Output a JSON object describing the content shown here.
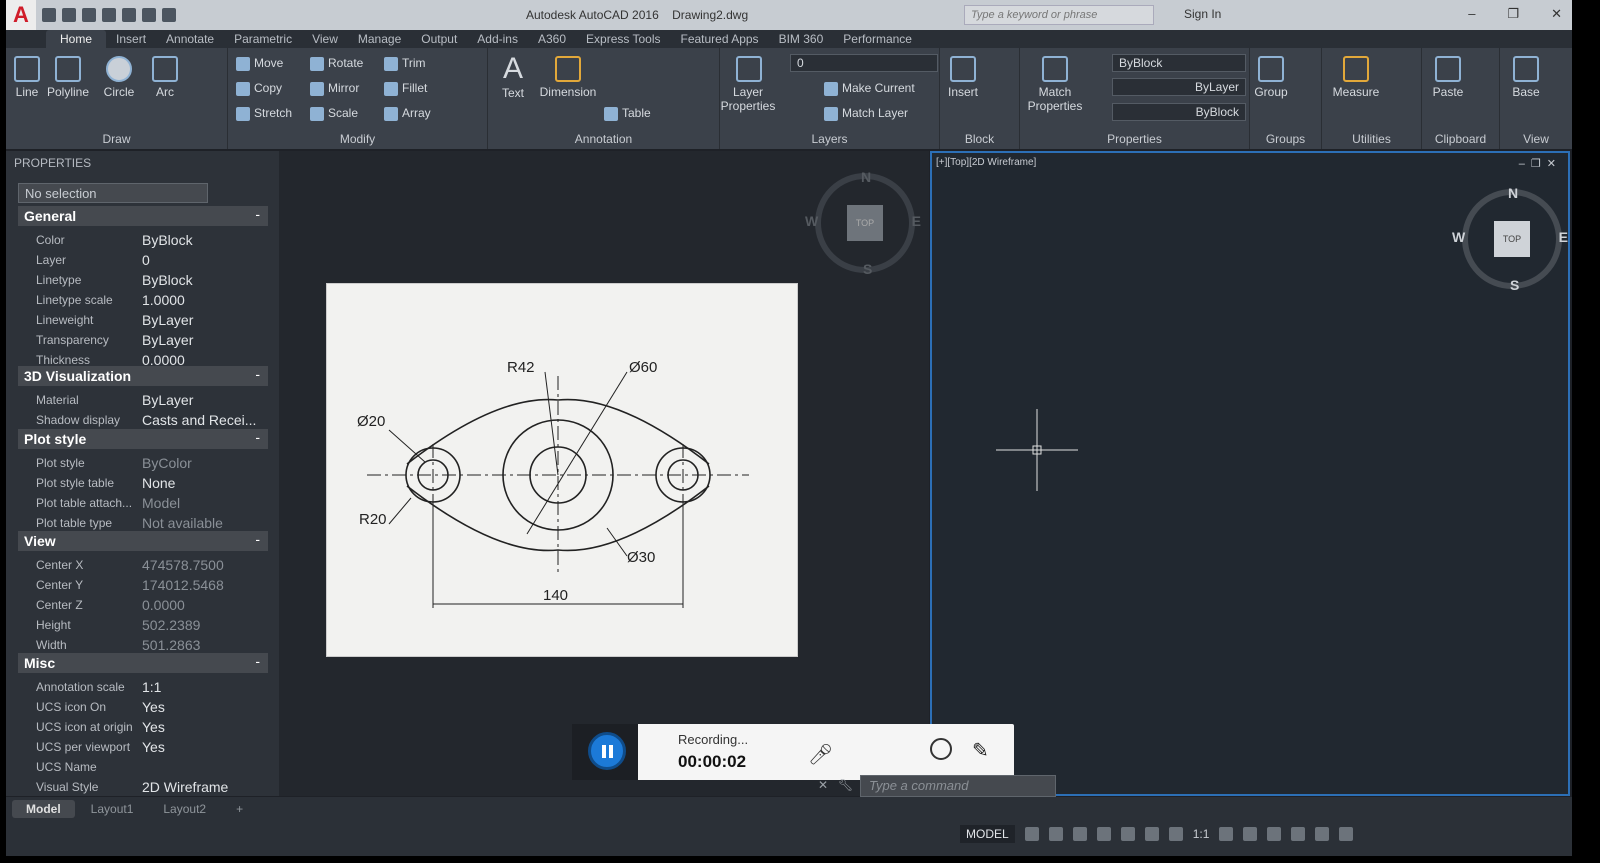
{
  "titlebar": {
    "app": "Autodesk AutoCAD 2016",
    "file": "Drawing2.dwg",
    "search_placeholder": "Type a keyword or phrase",
    "sign_in": "Sign In"
  },
  "tabs": [
    "Home",
    "Insert",
    "Annotate",
    "Parametric",
    "View",
    "Manage",
    "Output",
    "Add-ins",
    "A360",
    "Express Tools",
    "Featured Apps",
    "BIM 360",
    "Performance"
  ],
  "ribbon": {
    "draw": {
      "label": "Draw",
      "line": "Line",
      "polyline": "Polyline",
      "circle": "Circle",
      "arc": "Arc"
    },
    "modify": {
      "label": "Modify",
      "move": "Move",
      "rotate": "Rotate",
      "trim": "Trim",
      "copy": "Copy",
      "mirror": "Mirror",
      "fillet": "Fillet",
      "stretch": "Stretch",
      "scale": "Scale",
      "array": "Array"
    },
    "annotation": {
      "label": "Annotation",
      "text": "Text",
      "dimension": "Dimension",
      "table": "Table"
    },
    "layers": {
      "label": "Layers",
      "layer_props": "Layer Properties",
      "layer_value": "0",
      "make_current": "Make Current",
      "match_layer": "Match Layer"
    },
    "block": {
      "label": "Block",
      "insert": "Insert"
    },
    "properties": {
      "label": "Properties",
      "match": "Match Properties",
      "color": "ByBlock",
      "linetype": "ByLayer",
      "lineweight": "ByBlock"
    },
    "groups": {
      "label": "Groups",
      "group": "Group"
    },
    "utilities": {
      "label": "Utilities",
      "measure": "Measure"
    },
    "clipboard": {
      "label": "Clipboard",
      "paste": "Paste"
    },
    "view": {
      "label": "View",
      "base": "Base"
    }
  },
  "properties": {
    "header": "PROPERTIES",
    "selection": "No selection",
    "general": {
      "title": "General",
      "rows": [
        [
          "Color",
          "ByBlock"
        ],
        [
          "Layer",
          "0"
        ],
        [
          "Linetype",
          "ByBlock"
        ],
        [
          "Linetype scale",
          "1.0000"
        ],
        [
          "Lineweight",
          "ByLayer"
        ],
        [
          "Transparency",
          "ByLayer"
        ],
        [
          "Thickness",
          "0.0000"
        ]
      ]
    },
    "viz": {
      "title": "3D Visualization",
      "rows": [
        [
          "Material",
          "ByLayer"
        ],
        [
          "Shadow display",
          "Casts and Recei..."
        ]
      ]
    },
    "plot": {
      "title": "Plot style",
      "rows": [
        [
          "Plot style",
          "ByColor"
        ],
        [
          "Plot style table",
          "None"
        ],
        [
          "Plot table attach...",
          "Model"
        ],
        [
          "Plot table type",
          "Not available"
        ]
      ]
    },
    "view": {
      "title": "View",
      "rows": [
        [
          "Center X",
          "474578.7500"
        ],
        [
          "Center Y",
          "174012.5468"
        ],
        [
          "Center Z",
          "0.0000"
        ],
        [
          "Height",
          "502.2389"
        ],
        [
          "Width",
          "501.2863"
        ]
      ]
    },
    "misc": {
      "title": "Misc",
      "rows": [
        [
          "Annotation scale",
          "1:1"
        ],
        [
          "UCS icon On",
          "Yes"
        ],
        [
          "UCS icon at origin",
          "Yes"
        ],
        [
          "UCS per viewport",
          "Yes"
        ],
        [
          "UCS Name",
          ""
        ],
        [
          "Visual Style",
          "2D Wireframe"
        ]
      ]
    }
  },
  "viewcube": {
    "n": "N",
    "s": "S",
    "e": "E",
    "w": "W",
    "top": "TOP"
  },
  "viewport2": {
    "label": "[+][Top][2D Wireframe]"
  },
  "drawing": {
    "r42": "R42",
    "d60": "Ø60",
    "d20": "Ø20",
    "r20": "R20",
    "d30": "Ø30",
    "len": "140"
  },
  "recording": {
    "label": "Recording...",
    "time": "00:00:02"
  },
  "command": {
    "placeholder": "Type a command"
  },
  "layout_tabs": [
    "Model",
    "Layout1",
    "Layout2",
    "+"
  ],
  "status": {
    "model": "MODEL",
    "scale": "1:1"
  }
}
